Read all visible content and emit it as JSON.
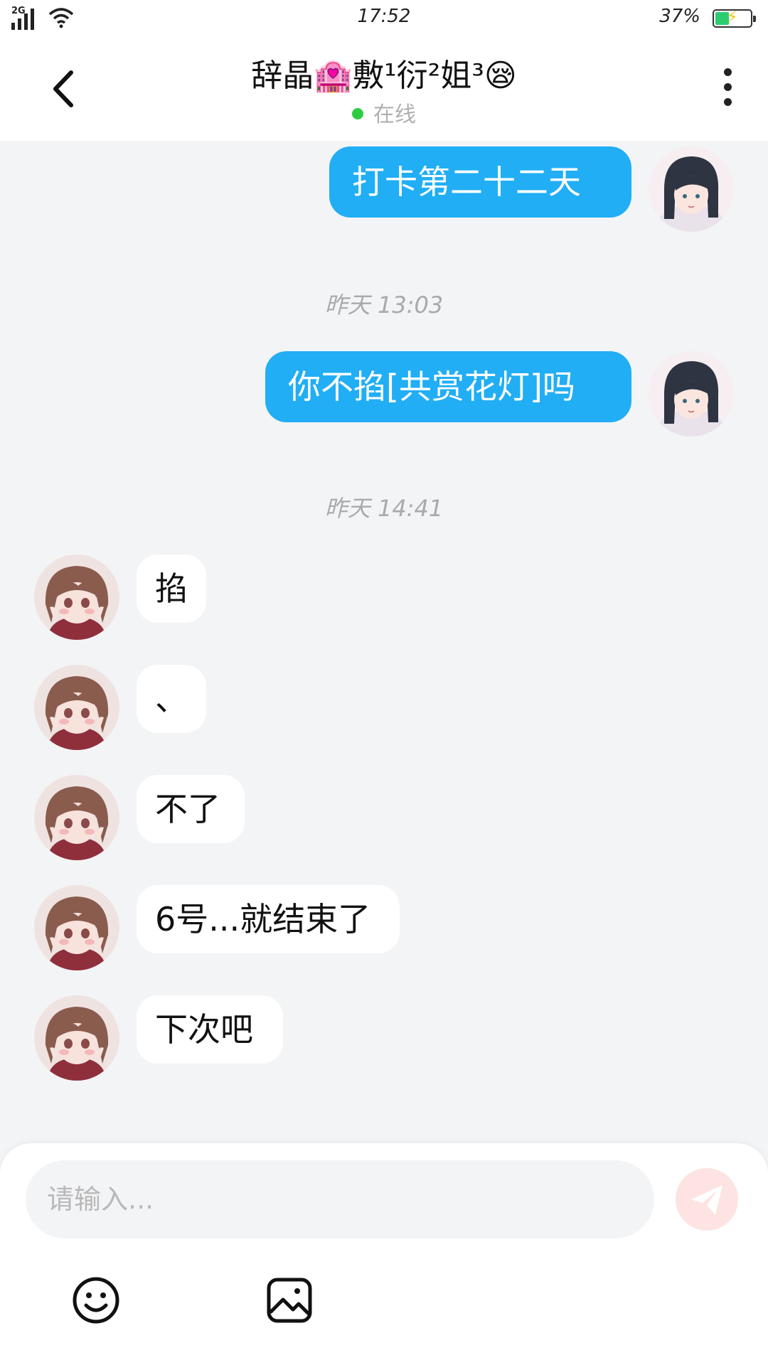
{
  "status_bar": {
    "network": "2G",
    "time": "17:52",
    "battery_percent": "37%",
    "battery_level": 0.37,
    "icons": [
      "signal-icon",
      "wifi-icon",
      "battery-charging-icon"
    ]
  },
  "header": {
    "title": "辞晶🏩敷¹衍²姐³😪",
    "status": "在线",
    "status_color": "#2ecc40",
    "icons": [
      "back-arrow-icon",
      "more-vertical-icon"
    ]
  },
  "messages": [
    {
      "type": "sent",
      "text": "打卡第二十二天",
      "avatar": "my-avatar"
    },
    {
      "type": "timestamp",
      "text": "昨天 13:03"
    },
    {
      "type": "sent",
      "text": "你不掐[共赏花灯]吗",
      "avatar": "my-avatar"
    },
    {
      "type": "timestamp",
      "text": "昨天 14:41"
    },
    {
      "type": "received",
      "text": "掐",
      "avatar": "contact-avatar"
    },
    {
      "type": "received",
      "text": "、",
      "avatar": "contact-avatar"
    },
    {
      "type": "received",
      "text": "不了",
      "avatar": "contact-avatar"
    },
    {
      "type": "received",
      "text": "6号...就结束了",
      "avatar": "contact-avatar"
    },
    {
      "type": "received",
      "text": "下次吧",
      "avatar": "contact-avatar"
    }
  ],
  "composer": {
    "placeholder": "请输入...",
    "icons": [
      "send-icon",
      "emoji-icon",
      "image-icon"
    ]
  },
  "colors": {
    "sent_bubble": "#21aef5",
    "received_bubble": "#ffffff",
    "background": "#f3f4f6",
    "send_button": "#fde3e1"
  }
}
